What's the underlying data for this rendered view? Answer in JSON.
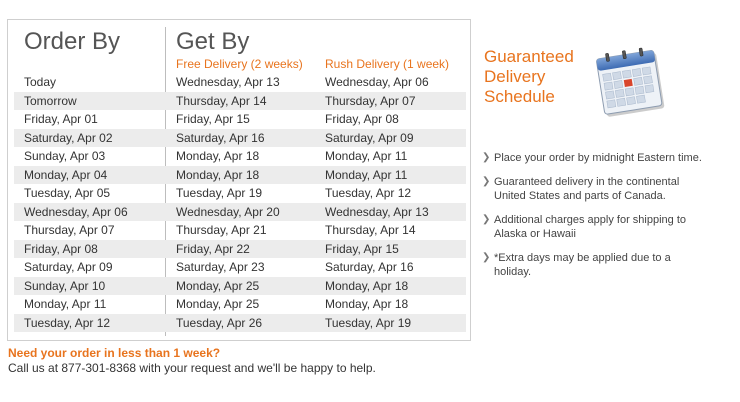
{
  "table": {
    "order_by": "Order By",
    "get_by": "Get By",
    "free_delivery": "Free Delivery (2 weeks)",
    "rush_delivery": "Rush Delivery (1 week)",
    "rows": [
      {
        "order": "Today",
        "free": "Wednesday, Apr 13",
        "rush": "Wednesday, Apr 06"
      },
      {
        "order": "Tomorrow",
        "free": "Thursday, Apr 14",
        "rush": "Thursday, Apr 07"
      },
      {
        "order": "Friday, Apr 01",
        "free": "Friday, Apr 15",
        "rush": "Friday, Apr 08"
      },
      {
        "order": "Saturday, Apr 02",
        "free": "Saturday, Apr 16",
        "rush": "Saturday, Apr 09"
      },
      {
        "order": "Sunday, Apr 03",
        "free": "Monday, Apr 18",
        "rush": "Monday, Apr 11"
      },
      {
        "order": "Monday, Apr 04",
        "free": "Monday, Apr 18",
        "rush": "Monday, Apr 11"
      },
      {
        "order": "Tuesday, Apr 05",
        "free": "Tuesday, Apr 19",
        "rush": "Tuesday, Apr 12"
      },
      {
        "order": "Wednesday, Apr 06",
        "free": "Wednesday, Apr 20",
        "rush": "Wednesday, Apr 13"
      },
      {
        "order": "Thursday, Apr 07",
        "free": "Thursday, Apr 21",
        "rush": "Thursday, Apr 14"
      },
      {
        "order": "Friday, Apr 08",
        "free": "Friday, Apr 22",
        "rush": "Friday, Apr 15"
      },
      {
        "order": "Saturday, Apr 09",
        "free": "Saturday, Apr 23",
        "rush": "Saturday, Apr 16"
      },
      {
        "order": "Sunday, Apr 10",
        "free": "Monday, Apr 25",
        "rush": "Monday, Apr 18"
      },
      {
        "order": "Monday, Apr 11",
        "free": "Monday, Apr 25",
        "rush": "Monday, Apr 18"
      },
      {
        "order": "Tuesday, Apr 12",
        "free": "Tuesday, Apr 26",
        "rush": "Tuesday, Apr 19"
      }
    ]
  },
  "sidebar": {
    "title_lines": [
      "Guaranteed",
      "Delivery",
      "Schedule"
    ],
    "icon": "calendar-icon",
    "notes": [
      "Place your order by midnight Eastern time.",
      "Guaranteed delivery in the continental United States and parts of Canada.",
      "Additional charges apply for shipping to Alaska or Hawaii",
      "*Extra days may be applied due to a holiday."
    ]
  },
  "cta": {
    "heading": "Need your order in less than 1 week?",
    "text": "Call us at 877-301-8368 with your request and we'll be happy to help."
  },
  "colors": {
    "accent": "#e8741e",
    "row_alt": "#ececec",
    "text": "#333333"
  }
}
